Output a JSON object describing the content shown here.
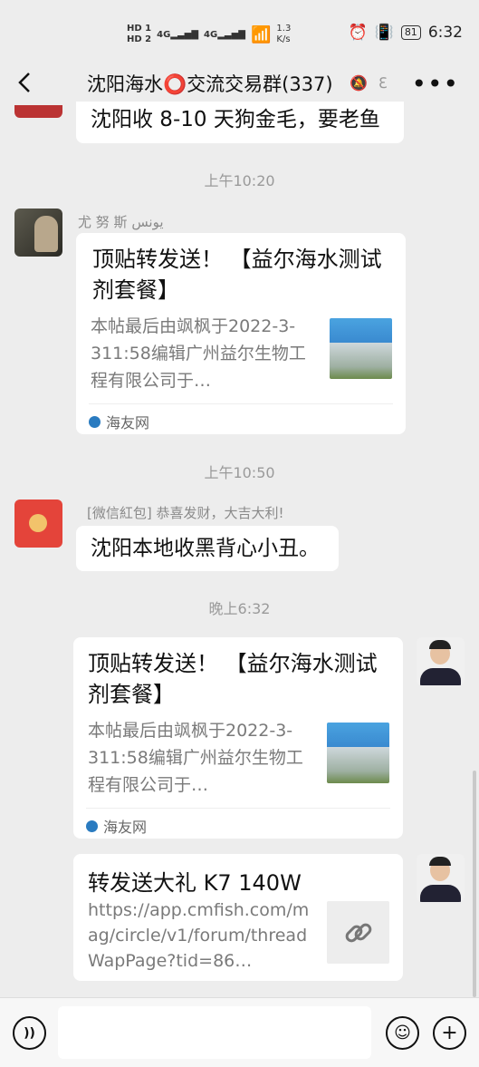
{
  "statusbar": {
    "net1": "HD 1",
    "net2": "HD 2",
    "sig1": "4G",
    "sig2": "4G",
    "speed": "1.3\nK/s",
    "battery": "81",
    "time": "6:32"
  },
  "header": {
    "title": "沈阳海水⭕交流交易群(337)"
  },
  "messages": {
    "top_partial": "沈阳收 8-10 天狗金毛，要老鱼",
    "time1": "上午10:20",
    "sender1": "尤 努 斯  يونس",
    "card1": {
      "title": "顶贴转发送！ 【益尔海水测试剂套餐】",
      "desc": "本帖最后由飒枫于2022-3-311:58编辑广州益尔生物工程有限公司于…",
      "source": "海友网"
    },
    "time2": "上午10:50",
    "sender2": "[微信紅包] 恭喜发财，大吉大利!",
    "text2": "沈阳本地收黑背心小丑。",
    "time3": "晚上6:32",
    "card2": {
      "title": "顶贴转发送！ 【益尔海水测试剂套餐】",
      "desc": "本帖最后由飒枫于2022-3-311:58编辑广州益尔生物工程有限公司于…",
      "source": "海友网"
    },
    "link": {
      "title": "转发送大礼 K7 140W",
      "url": "https://app.cmfish.com/mag/circle/v1/forum/threadWapPage?tid=86…"
    }
  },
  "colors": {
    "background": "#ededed",
    "bubble": "#ffffff",
    "redpacket": "#e4443a"
  }
}
